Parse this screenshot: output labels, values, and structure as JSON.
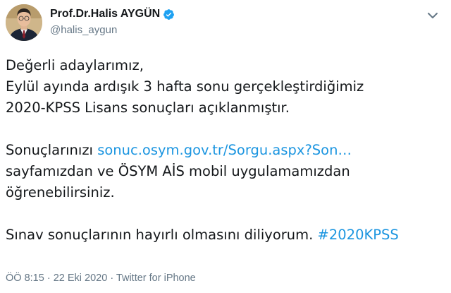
{
  "author": {
    "display_name": "Prof.Dr.Halis AYGÜN",
    "handle": "@halis_aygun"
  },
  "tweet": {
    "line1": "Değerli adaylarımız,",
    "line2": "Eylül ayında ardışık 3 hafta sonu gerçekleştirdiğimiz",
    "line3": "2020-KPSS Lisans sonuçları açıklanmıştır.",
    "line4_prefix": "Sonuçlarınızı ",
    "link_text": "sonuc.osym.gov.tr/Sorgu.aspx?Son…",
    "line5": "sayfamızdan ve ÖSYM AİS mobil uygulamamızdan",
    "line6": "öğrenebilirsiniz.",
    "line7_prefix": "Sınav sonuçlarının hayırlı olmasını diliyorum. ",
    "hashtag": "#2020KPSS"
  },
  "footer": {
    "time": "ÖÖ 8:15",
    "separator1": " · ",
    "date": "22 Eki 2020",
    "separator2": " · ",
    "source": "Twitter for iPhone"
  },
  "colors": {
    "link": "#1b95e0",
    "text": "#14171a",
    "muted": "#657786",
    "verified": "#1da1f2"
  },
  "icons": {
    "verified": "verified-badge-icon",
    "more": "chevron-down-icon"
  }
}
